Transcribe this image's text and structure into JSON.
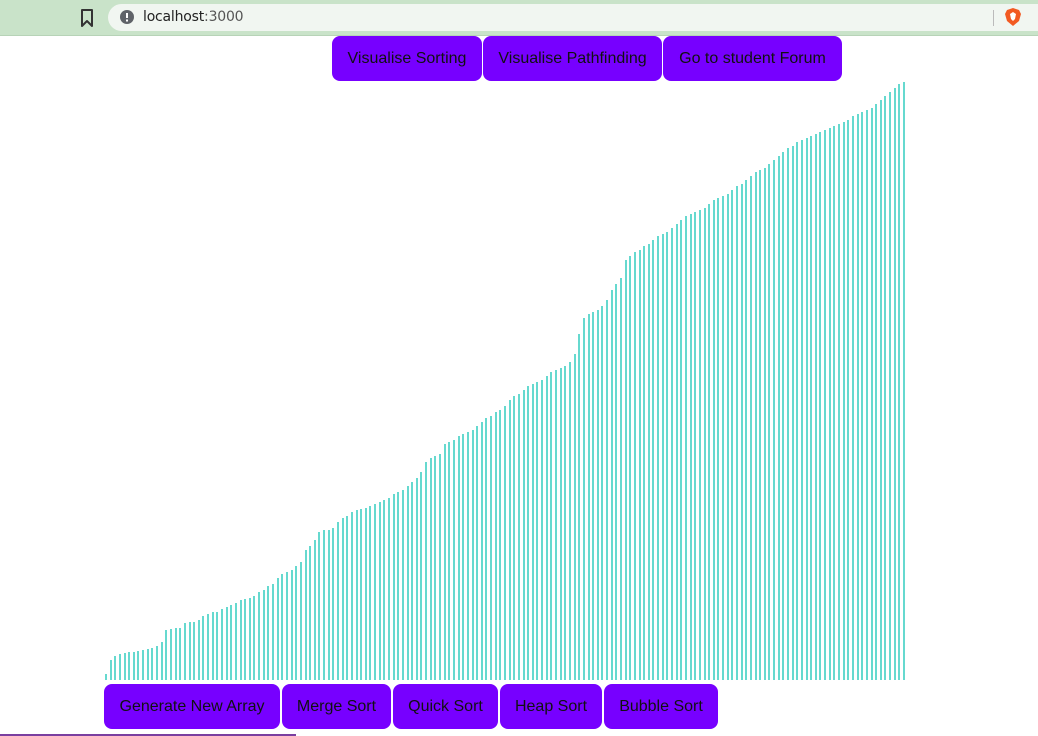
{
  "browser": {
    "url_host": "localhost",
    "url_port": ":3000"
  },
  "nav": {
    "sorting_label": "Visualise Sorting",
    "pathfinding_label": "Visualise Pathfinding",
    "forum_label": "Go to student Forum"
  },
  "controls": {
    "generate_label": "Generate New Array",
    "merge_label": "Merge Sort",
    "quick_label": "Quick Sort",
    "heap_label": "Heap Sort",
    "bubble_label": "Bubble Sort"
  },
  "bar_color": "#66d9cf",
  "button_color": "#7700ff",
  "array": [
    6,
    20,
    24,
    26,
    27,
    28,
    28,
    29,
    30,
    31,
    32,
    34,
    38,
    50,
    51,
    52,
    52,
    57,
    58,
    58,
    60,
    64,
    66,
    68,
    68,
    71,
    73,
    75,
    77,
    80,
    81,
    82,
    84,
    88,
    90,
    94,
    96,
    102,
    106,
    108,
    110,
    114,
    118,
    130,
    134,
    140,
    148,
    150,
    150,
    152,
    158,
    162,
    164,
    168,
    170,
    171,
    172,
    174,
    176,
    178,
    180,
    182,
    186,
    188,
    190,
    194,
    198,
    202,
    208,
    218,
    222,
    224,
    226,
    236,
    238,
    240,
    244,
    246,
    248,
    250,
    254,
    258,
    262,
    264,
    268,
    270,
    274,
    280,
    284,
    286,
    290,
    294,
    296,
    298,
    300,
    304,
    308,
    310,
    312,
    314,
    318,
    326,
    346,
    362,
    366,
    368,
    370,
    374,
    380,
    390,
    396,
    402,
    420,
    424,
    428,
    430,
    434,
    436,
    440,
    444,
    446,
    448,
    452,
    456,
    460,
    464,
    466,
    468,
    470,
    472,
    476,
    480,
    482,
    484,
    486,
    490,
    494,
    496,
    500,
    504,
    508,
    510,
    512,
    516,
    520,
    524,
    528,
    532,
    534,
    538,
    540,
    542,
    544,
    546,
    548,
    550,
    552,
    554,
    556,
    558,
    560,
    564,
    566,
    568,
    570,
    572,
    576,
    580,
    584,
    588,
    592,
    596,
    598
  ]
}
